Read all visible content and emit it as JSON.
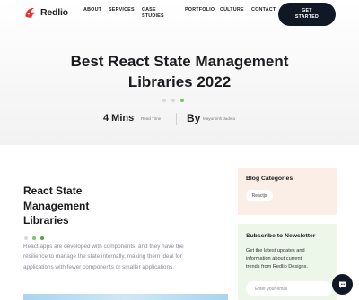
{
  "brand": {
    "name": "Redlio",
    "accent": "#e8322f"
  },
  "nav": {
    "about": "ABOUT",
    "services": "SERVICES",
    "case_studies_line1": "CASE",
    "case_studies_line2": "STUDIES",
    "portfolio": "PORTFOLIO",
    "culture": "CULTURE",
    "contact": "CONTACT",
    "cta_line1": "GET",
    "cta_line2": "STARTED"
  },
  "hero": {
    "title_line1": "Best React State Management",
    "title_line2": "Libraries 2022",
    "read_time_value": "4 Mins",
    "read_time_label": "Read Time",
    "by_label": "By",
    "author": "Mayursinh Jadeja"
  },
  "article": {
    "heading_line1": "React State",
    "heading_line2": "Management",
    "heading_line3": "Libraries",
    "paragraph_line1": "React apps are developed with components, and they have the",
    "paragraph_line2": "resilience to manage the state internally, making them ideal for",
    "paragraph_line3": "applications with fewer components or smaller applications."
  },
  "sidebar": {
    "categories_title": "Blog Categories",
    "category_chip": "Reactjs",
    "newsletter_title": "Subscribe to Newsletter",
    "newsletter_line1": "Get the latest updates and",
    "newsletter_line2": "information about current",
    "newsletter_line3": "trends from Redlio Designs.",
    "email_placeholder": "Enter your email"
  },
  "icons": {
    "chat": "chat-bubble-icon",
    "logo": "redlio-logo-icon"
  },
  "colors": {
    "dot_light": "#d9d9d9",
    "dot_green": "#7cc36b",
    "dot_green_2": "#4fa63b",
    "cta_bg": "#101826"
  }
}
